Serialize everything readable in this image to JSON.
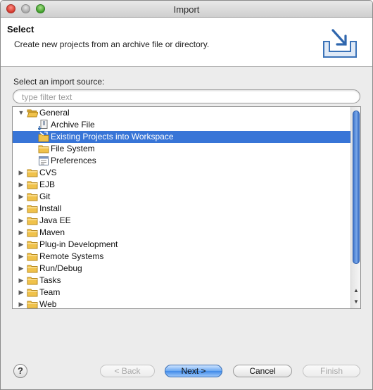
{
  "window": {
    "title": "Import"
  },
  "header": {
    "title": "Select",
    "description": "Create new projects from an archive file or directory."
  },
  "source": {
    "label": "Select an import source:",
    "filter_placeholder": "type filter text",
    "filter_value": ""
  },
  "tree": {
    "items": [
      {
        "label": "General",
        "level": 0,
        "expanded": true,
        "icon": "folder-open-icon"
      },
      {
        "label": "Archive File",
        "level": 1,
        "icon": "archive-file-icon"
      },
      {
        "label": "Existing Projects into Workspace",
        "level": 1,
        "icon": "existing-projects-icon",
        "selected": true
      },
      {
        "label": "File System",
        "level": 1,
        "icon": "folder-icon"
      },
      {
        "label": "Preferences",
        "level": 1,
        "icon": "preferences-icon"
      },
      {
        "label": "CVS",
        "level": 0,
        "expanded": false,
        "icon": "folder-icon"
      },
      {
        "label": "EJB",
        "level": 0,
        "expanded": false,
        "icon": "folder-icon"
      },
      {
        "label": "Git",
        "level": 0,
        "expanded": false,
        "icon": "folder-icon"
      },
      {
        "label": "Install",
        "level": 0,
        "expanded": false,
        "icon": "folder-icon"
      },
      {
        "label": "Java EE",
        "level": 0,
        "expanded": false,
        "icon": "folder-icon"
      },
      {
        "label": "Maven",
        "level": 0,
        "expanded": false,
        "icon": "folder-icon"
      },
      {
        "label": "Plug-in Development",
        "level": 0,
        "expanded": false,
        "icon": "folder-icon"
      },
      {
        "label": "Remote Systems",
        "level": 0,
        "expanded": false,
        "icon": "folder-icon"
      },
      {
        "label": "Run/Debug",
        "level": 0,
        "expanded": false,
        "icon": "folder-icon"
      },
      {
        "label": "Tasks",
        "level": 0,
        "expanded": false,
        "icon": "folder-icon"
      },
      {
        "label": "Team",
        "level": 0,
        "expanded": false,
        "icon": "folder-icon"
      },
      {
        "label": "Web",
        "level": 0,
        "expanded": false,
        "icon": "folder-icon"
      }
    ]
  },
  "footer": {
    "help_label": "?",
    "back_label": "< Back",
    "next_label": "Next >",
    "cancel_label": "Cancel",
    "finish_label": "Finish"
  },
  "colors": {
    "selection": "#3875d7",
    "folder": "#f0c24b",
    "default_button": "#3f8ae8"
  }
}
